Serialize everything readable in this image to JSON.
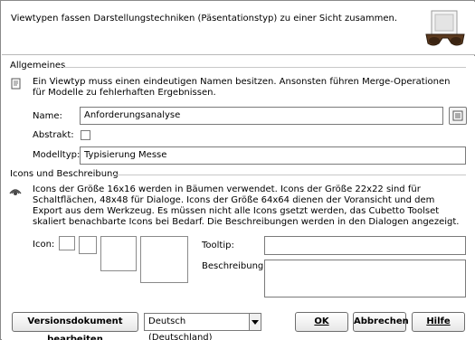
{
  "header": {
    "description": "Viewtypen fassen Darstellungstechniken (Päsentationstyp) zu einer Sicht zusammen.",
    "icon": "view-glasses-icon"
  },
  "general": {
    "title": "Allgemeines",
    "info": "Ein Viewtyp muss einen eindeutigen Namen besitzen. Ansonsten führen Merge-Operationen für Modelle zu fehlerhaften Ergebnissen.",
    "name_label": "Name:",
    "name_value": "Anforderungsanalyse",
    "abstract_label": "Abstrakt:",
    "abstract_checked": false,
    "modeltype_label": "Modelltyp:",
    "modeltype_value": "Typisierung Messe"
  },
  "icons": {
    "title": "Icons und Beschreibung",
    "info": "Icons der Größe 16x16 werden in Bäumen verwendet. Icons der Größe 22x22 sind für Schaltflächen, 48x48 für Dialoge. Icons der Größe 64x64 dienen der Voransicht und dem Export aus dem Werkzeug. Es müssen nicht alle Icons gsetzt werden, das Cubetto Toolset skaliert benachbarte Icons bei Bedarf. Die Beschreibungen werden in den Dialogen angezeigt.",
    "icon_label": "Icon:",
    "tooltip_label": "Tooltip:",
    "tooltip_value": "",
    "description_label": "Beschreibung:",
    "description_value": ""
  },
  "footer": {
    "edit_version_button": "Versionsdokument bearbeiten",
    "language_value": "Deutsch (Deutschland)",
    "ok_button": "OK",
    "cancel_button": "Abbrechen",
    "help_button": "Hilfe"
  }
}
